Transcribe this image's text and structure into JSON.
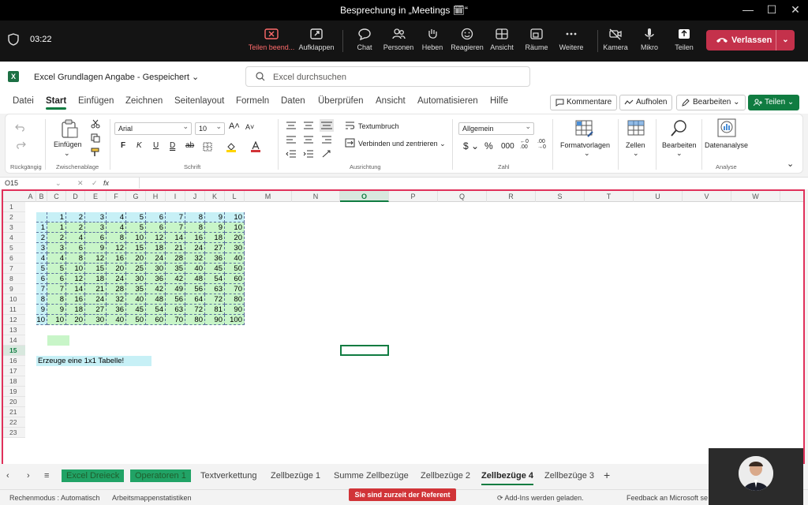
{
  "window": {
    "title": "Besprechung in „Meetings 🗓“"
  },
  "meeting": {
    "timer": "03:22",
    "buttons": [
      {
        "label": "Teilen beend...",
        "icon": "stop-share-icon"
      },
      {
        "label": "Aufklappen",
        "icon": "popout-icon"
      },
      {
        "label": "Chat",
        "icon": "chat-icon"
      },
      {
        "label": "Personen",
        "icon": "people-icon"
      },
      {
        "label": "Heben",
        "icon": "raise-hand-icon"
      },
      {
        "label": "Reagieren",
        "icon": "react-icon"
      },
      {
        "label": "Ansicht",
        "icon": "view-icon"
      },
      {
        "label": "Räume",
        "icon": "rooms-icon"
      },
      {
        "label": "Weitere",
        "icon": "more-icon"
      },
      {
        "label": "Kamera",
        "icon": "camera-off-icon"
      },
      {
        "label": "Mikro",
        "icon": "mic-icon"
      },
      {
        "label": "Teilen",
        "icon": "share-icon"
      }
    ],
    "leave_label": "Verlassen",
    "leave_color": "#c4314b"
  },
  "excel": {
    "doc_title": "Excel Grundlagen Angabe  -  Gespeichert ⌄",
    "search_placeholder": "Excel durchsuchen",
    "tabs": [
      "Datei",
      "Start",
      "Einfügen",
      "Zeichnen",
      "Seitenlayout",
      "Formeln",
      "Daten",
      "Überprüfen",
      "Ansicht",
      "Automatisieren",
      "Hilfe"
    ],
    "active_tab": "Start",
    "comments_label": "Kommentare",
    "catchup_label": "Aufholen",
    "edit_label": "Bearbeiten ⌄",
    "share_label": "Teilen ⌄",
    "ribbon": {
      "undo_group": "Rückgängig",
      "paste_label": "Einfügen",
      "clipboard_group": "Zwischenablage",
      "font_name": "Arial",
      "font_size": "10",
      "font_group": "Schrift",
      "wrap_label": "Textumbruch",
      "merge_label": "Verbinden und zentrieren ⌄",
      "align_group": "Ausrichtung",
      "number_format": "Allgemein",
      "number_group": "Zahl",
      "format_templates": "Formatvorlagen",
      "cells": "Zellen",
      "editing": "Bearbeiten",
      "data_analysis": "Datenanalyse",
      "analysis_group": "Analyse"
    },
    "name_box": "O15",
    "formula_icon": "fx"
  },
  "sheet": {
    "columns": [
      "A",
      "B",
      "C",
      "D",
      "E",
      "F",
      "G",
      "H",
      "I",
      "J",
      "K",
      "L",
      "M",
      "N",
      "O",
      "P",
      "Q",
      "R",
      "S",
      "T",
      "U",
      "V",
      "W"
    ],
    "selected_column": "O",
    "rows": [
      "1",
      "2",
      "3",
      "4",
      "5",
      "6",
      "7",
      "8",
      "9",
      "10",
      "11",
      "12",
      "13",
      "14",
      "15",
      "16",
      "17",
      "18",
      "19",
      "20",
      "21",
      "22",
      "23"
    ],
    "selected_row": "15",
    "table_header": [
      "",
      "1",
      "2",
      "3",
      "4",
      "5",
      "6",
      "7",
      "8",
      "9",
      "10"
    ],
    "table_rows": [
      [
        "1",
        "1",
        "2",
        "3",
        "4",
        "5",
        "6",
        "7",
        "8",
        "9",
        "10"
      ],
      [
        "2",
        "2",
        "4",
        "6",
        "8",
        "10",
        "12",
        "14",
        "16",
        "18",
        "20"
      ],
      [
        "3",
        "3",
        "6",
        "9",
        "12",
        "15",
        "18",
        "21",
        "24",
        "27",
        "30"
      ],
      [
        "4",
        "4",
        "8",
        "12",
        "16",
        "20",
        "24",
        "28",
        "32",
        "36",
        "40"
      ],
      [
        "5",
        "5",
        "10",
        "15",
        "20",
        "25",
        "30",
        "35",
        "40",
        "45",
        "50"
      ],
      [
        "6",
        "6",
        "12",
        "18",
        "24",
        "30",
        "36",
        "42",
        "48",
        "54",
        "60"
      ],
      [
        "7",
        "7",
        "14",
        "21",
        "28",
        "35",
        "42",
        "49",
        "56",
        "63",
        "70"
      ],
      [
        "8",
        "8",
        "16",
        "24",
        "32",
        "40",
        "48",
        "56",
        "64",
        "72",
        "80"
      ],
      [
        "9",
        "9",
        "18",
        "27",
        "36",
        "45",
        "54",
        "63",
        "72",
        "81",
        "90"
      ],
      [
        "10",
        "10",
        "20",
        "30",
        "40",
        "50",
        "60",
        "70",
        "80",
        "90",
        "100"
      ]
    ],
    "note": "Erzeuge eine 1x1 Tabelle!",
    "header_color": "#c7f0f6",
    "body_color": "#c8f5c8"
  },
  "sheet_tabs": [
    {
      "label": "Excel Dreieck",
      "style": "green"
    },
    {
      "label": "Operatoren 1",
      "style": "green"
    },
    {
      "label": "Textverkettung",
      "style": "normal"
    },
    {
      "label": "Zellbezüge 1",
      "style": "normal"
    },
    {
      "label": "Summe Zellbezüge",
      "style": "normal"
    },
    {
      "label": "Zellbezüge 2",
      "style": "normal"
    },
    {
      "label": "Zellbezüge 4",
      "style": "active"
    },
    {
      "label": "Zellbezüge 3",
      "style": "normal"
    }
  ],
  "status": {
    "calc_mode": "Rechenmodus : Automatisch",
    "stats": "Arbeitsmappenstatistiken",
    "presenter": "Sie sind zurzeit der Referent",
    "addins": "Add-Ins werden geladen.",
    "feedback": "Feedback an Microsoft se"
  }
}
